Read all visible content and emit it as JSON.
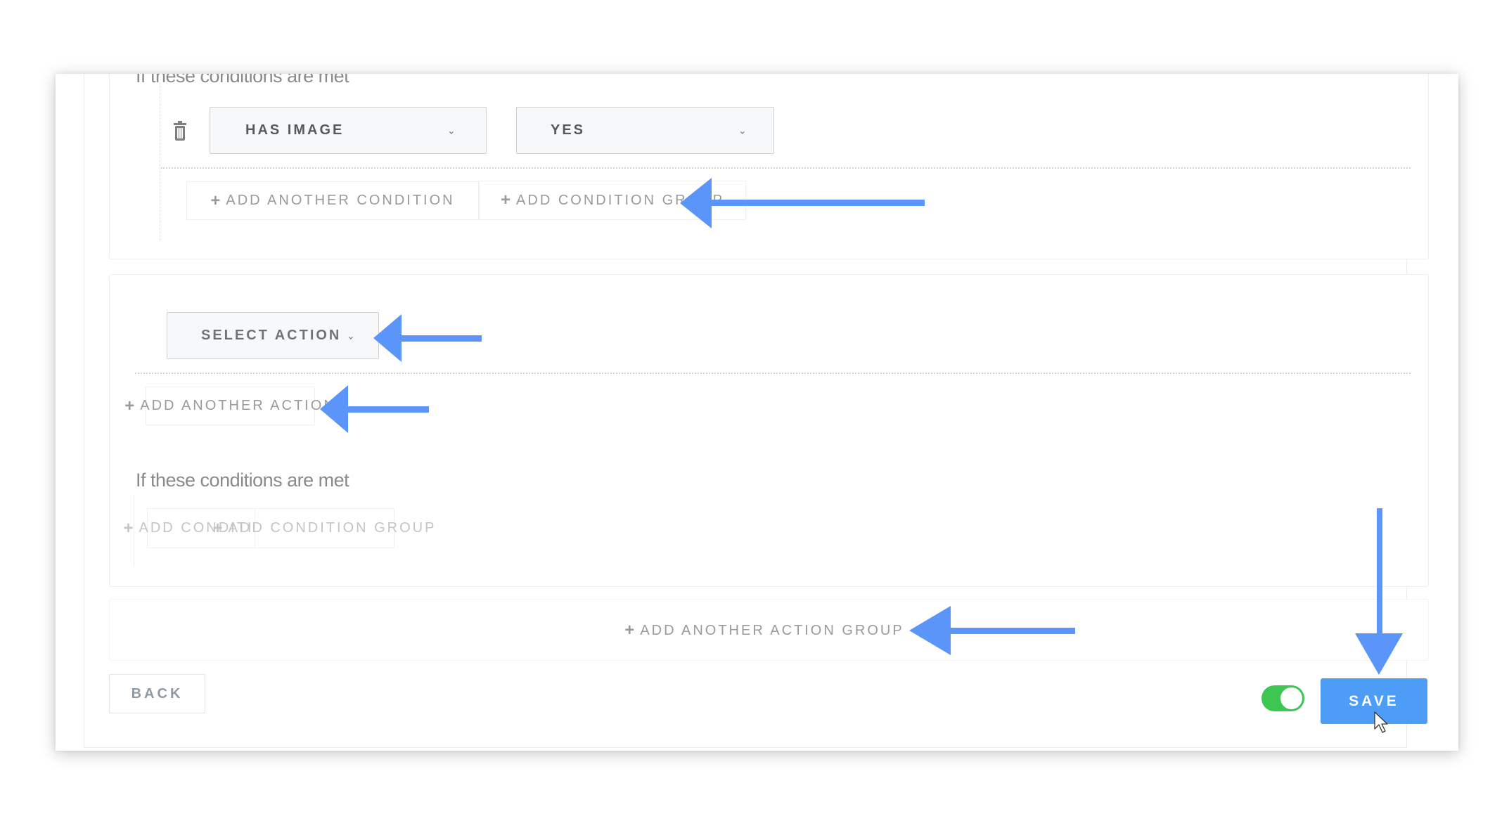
{
  "condition_group_1": {
    "label": "If these conditions are met",
    "condition": {
      "field_value": "HAS IMAGE",
      "operator_value": "YES",
      "delete_icon": "trash-icon",
      "chevron_icon": "chevron-down-icon"
    },
    "add_condition_label": "ADD ANOTHER CONDITION",
    "add_condition_group_label": "ADD CONDITION GROUP"
  },
  "action_group": {
    "select_action_placeholder": "SELECT ACTION",
    "add_action_label": "ADD ANOTHER ACTION",
    "conditions_label": "If these conditions are met",
    "add_condition_label": "ADD CONDITION",
    "add_condition_group_label": "ADD CONDITION GROUP"
  },
  "add_action_group_label": "ADD ANOTHER ACTION GROUP",
  "footer": {
    "back_label": "BACK",
    "enabled_toggle": true,
    "save_label": "SAVE"
  },
  "icons": {
    "plus": "+",
    "chevron": "⌄"
  },
  "annotation": {
    "arrow_color": "#5b95f9",
    "arrows": [
      "add-condition-group",
      "select-action",
      "add-another-action",
      "add-another-action-group",
      "save"
    ]
  },
  "colors": {
    "save": "#4d9cf6",
    "toggle_on": "#3dc752"
  }
}
